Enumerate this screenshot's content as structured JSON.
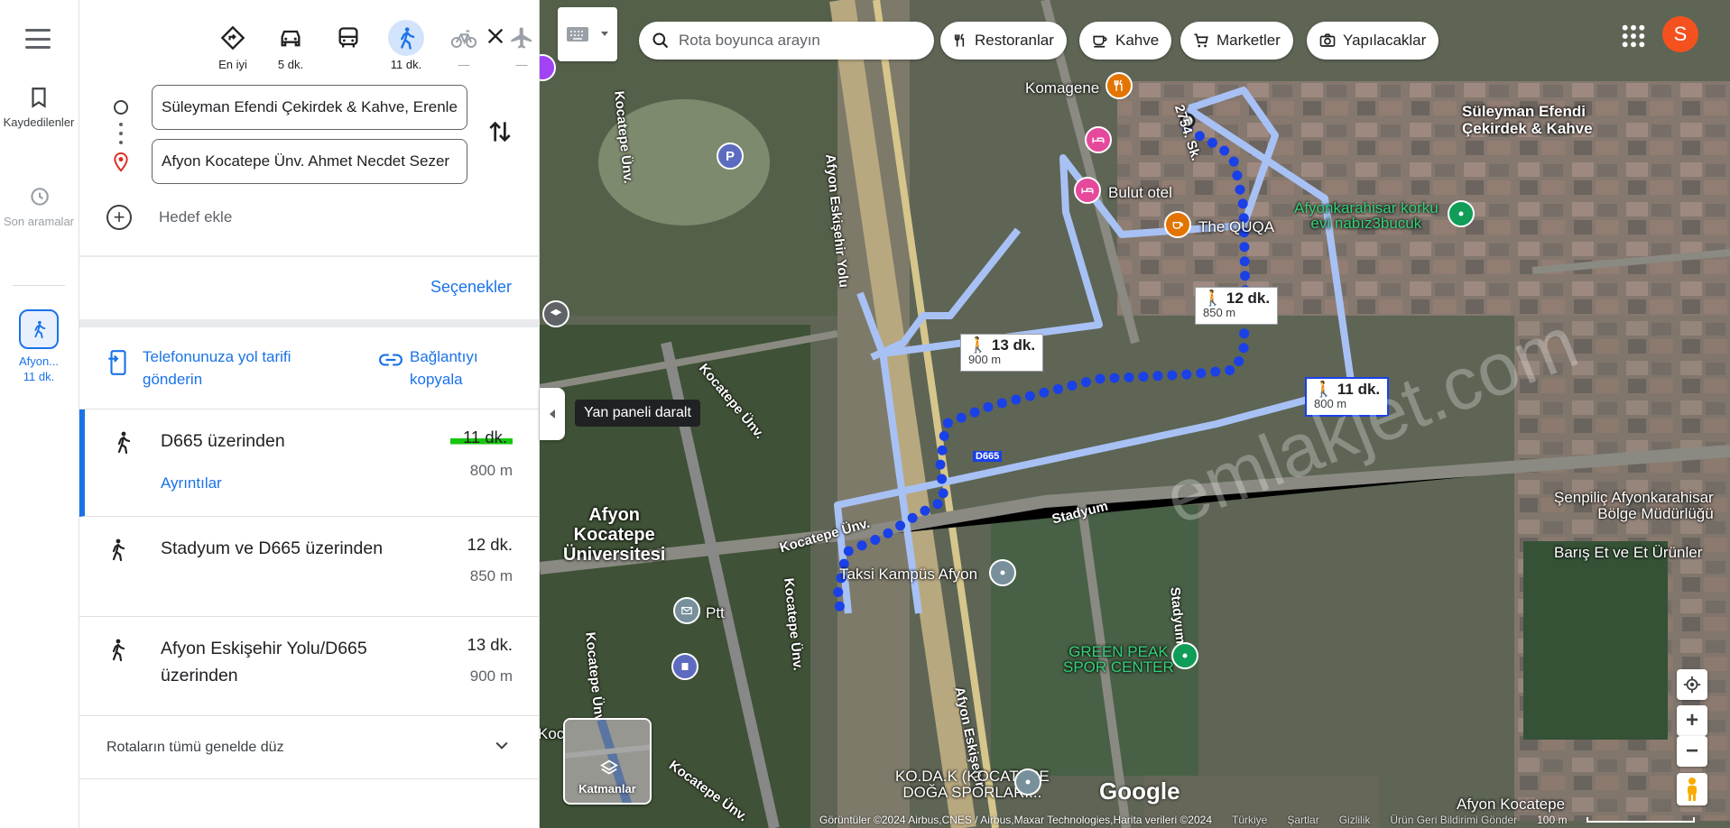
{
  "rail": {
    "saved_label": "Kaydedilenler",
    "recent_label": "Son aramalar",
    "route_label": "Afyon...",
    "route_time": "11 dk."
  },
  "modes": [
    {
      "name": "best",
      "label": "En iyi"
    },
    {
      "name": "car",
      "label": "5 dk."
    },
    {
      "name": "transit",
      "label": ""
    },
    {
      "name": "walk",
      "label": "11 dk."
    },
    {
      "name": "bike",
      "label": "—"
    },
    {
      "name": "flight",
      "label": "—"
    }
  ],
  "directions": {
    "origin": "Süleyman Efendi Çekirdek & Kahve, Erenler",
    "destination": "Afyon Kocatepe Ünv. Ahmet Necdet Sezer",
    "add_stop": "Hedef ekle",
    "options": "Seçenekler",
    "send_to_phone": [
      "Telefonunuza yol tarifi",
      "gönderin"
    ],
    "copy_link": [
      "Bağlantıyı",
      "kopyala"
    ],
    "routes": [
      {
        "name": "D665 üzerinden",
        "time": "11 dk.",
        "distance": "800 m",
        "details": "Ayrıntılar"
      },
      {
        "name": "Stadyum ve D665 üzerinden",
        "time": "12 dk.",
        "distance": "850 m"
      },
      {
        "name": "Afyon Eskişehir Yolu/D665 üzerinden",
        "time": "13 dk.",
        "distance": "900 m"
      }
    ],
    "flat_note": "Rotaların tümü genelde düz"
  },
  "map": {
    "search_placeholder": "Rota boyunca arayın",
    "chips": [
      "Restoranlar",
      "Kahve",
      "Marketler",
      "Yapılacaklar"
    ],
    "avatar_letter": "S",
    "tooltip": "Yan paneli daralt",
    "layers_label": "Katmanlar",
    "google": "Google",
    "labels": {
      "origin_name": [
        "Süleyman Efendi",
        "Çekirdek & Kahve"
      ],
      "komagene": "Komagene",
      "bulut": "Bulut otel",
      "quqa": "The QUQA",
      "korku": [
        "Afyonkarahisar korku",
        "evi nabız3bucuk"
      ],
      "afyon_kocatepe_uni": [
        "Afyon",
        "Kocatepe",
        "Üniversitesi"
      ],
      "taksi": "Taksi Kampüs Afyon",
      "ptt": "Ptt",
      "green_peak": [
        "GREEN PEAK",
        "SPOR CENTER"
      ],
      "kodak": [
        "KO.DA.K (KOCATEPE",
        "DOĞA SPORLARI..."
      ],
      "senpilic": [
        "Şenpiliç Afyonkarahisar",
        "Bölge Müdürlüğü"
      ],
      "baris": "Barış Et ve Et Ürünler",
      "afyon_kocatepe_bottom": "Afyon Kocatepe",
      "kocatepe_bottom_left": "Kocatepe"
    },
    "roads": {
      "afyon_eskisehir_yolu": "Afyon Eskişehir Yolu",
      "afyon_eskisehir_bottom": "Afyon Eskişehir",
      "kocatepe_unv": "Kocatepe Ünv.",
      "stadyum": "Stadyum",
      "sk2754": "2754. Sk.",
      "d665": "D665"
    },
    "callouts": [
      {
        "time": "12 dk.",
        "dist": "850 m"
      },
      {
        "time": "13 dk.",
        "dist": "900 m"
      },
      {
        "time": "11 dk.",
        "dist": "800 m"
      }
    ],
    "watermark": "emlakjet.com",
    "attribution": {
      "imagery": "Görüntüler ©2024 Airbus,CNES / Airbus,Maxar Technologies,Harita verileri ©2024",
      "turkey": "Türkiye",
      "terms": "Şartlar",
      "privacy": "Gizlilik",
      "feedback": "Ürün Geri Bildirimi Gönder",
      "scale": "100 m"
    }
  },
  "colors": {
    "accent": "#1a73e8",
    "route_primary": "#1a40e8",
    "route_alt": "#a8c1f5",
    "avatar": "#f4511e",
    "highlight": "#16c60c"
  }
}
